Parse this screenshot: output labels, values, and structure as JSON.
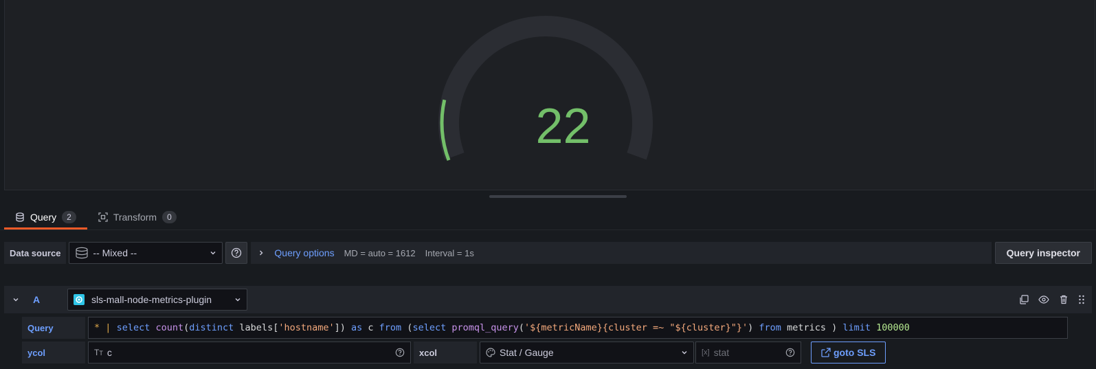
{
  "gauge": {
    "value": "22",
    "fraction": 0.11,
    "value_color": "#73bf69",
    "track_color": "#2b2d33"
  },
  "tabs": [
    {
      "label": "Query",
      "count": "2",
      "icon": "database-icon"
    },
    {
      "label": "Transform",
      "count": "0",
      "icon": "transform-icon"
    }
  ],
  "datasource": {
    "label": "Data source",
    "value": "-- Mixed --",
    "help_icon": "question-circle-icon"
  },
  "query_options": {
    "title": "Query options",
    "md": "MD = auto = 1612",
    "interval": "Interval = 1s"
  },
  "inspector_label": "Query inspector",
  "query_a": {
    "letter": "A",
    "datasource": "sls-mall-node-metrics-plugin",
    "icons": [
      "copy-icon",
      "eye-icon",
      "trash-icon",
      "drag-handle-icon"
    ]
  },
  "query_field": {
    "label": "Query",
    "tokens": [
      {
        "t": "*",
        "c": "k-op"
      },
      {
        "t": " ",
        "c": ""
      },
      {
        "t": "|",
        "c": "k-op"
      },
      {
        "t": " ",
        "c": ""
      },
      {
        "t": "select",
        "c": "k-fn"
      },
      {
        "t": " ",
        "c": ""
      },
      {
        "t": "count",
        "c": "k-kw"
      },
      {
        "t": "(",
        "c": ""
      },
      {
        "t": "distinct",
        "c": "k-fn"
      },
      {
        "t": " labels[",
        "c": ""
      },
      {
        "t": "'hostname'",
        "c": "k-str"
      },
      {
        "t": "]) ",
        "c": ""
      },
      {
        "t": "as",
        "c": "k-fn"
      },
      {
        "t": " c ",
        "c": ""
      },
      {
        "t": "from",
        "c": "k-fn"
      },
      {
        "t": " (",
        "c": ""
      },
      {
        "t": "select",
        "c": "k-fn"
      },
      {
        "t": " ",
        "c": ""
      },
      {
        "t": "promql_query",
        "c": "k-kw"
      },
      {
        "t": "(",
        "c": ""
      },
      {
        "t": "'${metricName}{cluster =~ \"${cluster}\"}'",
        "c": "k-str"
      },
      {
        "t": ") ",
        "c": ""
      },
      {
        "t": "from",
        "c": "k-fn"
      },
      {
        "t": " metrics ) ",
        "c": ""
      },
      {
        "t": "limit",
        "c": "k-fn"
      },
      {
        "t": " ",
        "c": ""
      },
      {
        "t": "100000",
        "c": "k-num"
      }
    ]
  },
  "ycol": {
    "label": "ycol",
    "value": "c"
  },
  "xcol": {
    "label": "xcol",
    "value": "Stat / Gauge"
  },
  "stat_input": {
    "placeholder": "stat"
  },
  "goto_label": "goto SLS",
  "colors": {
    "accent": "#6e9fff",
    "tab_active": "#f05a28",
    "success": "#73bf69"
  }
}
